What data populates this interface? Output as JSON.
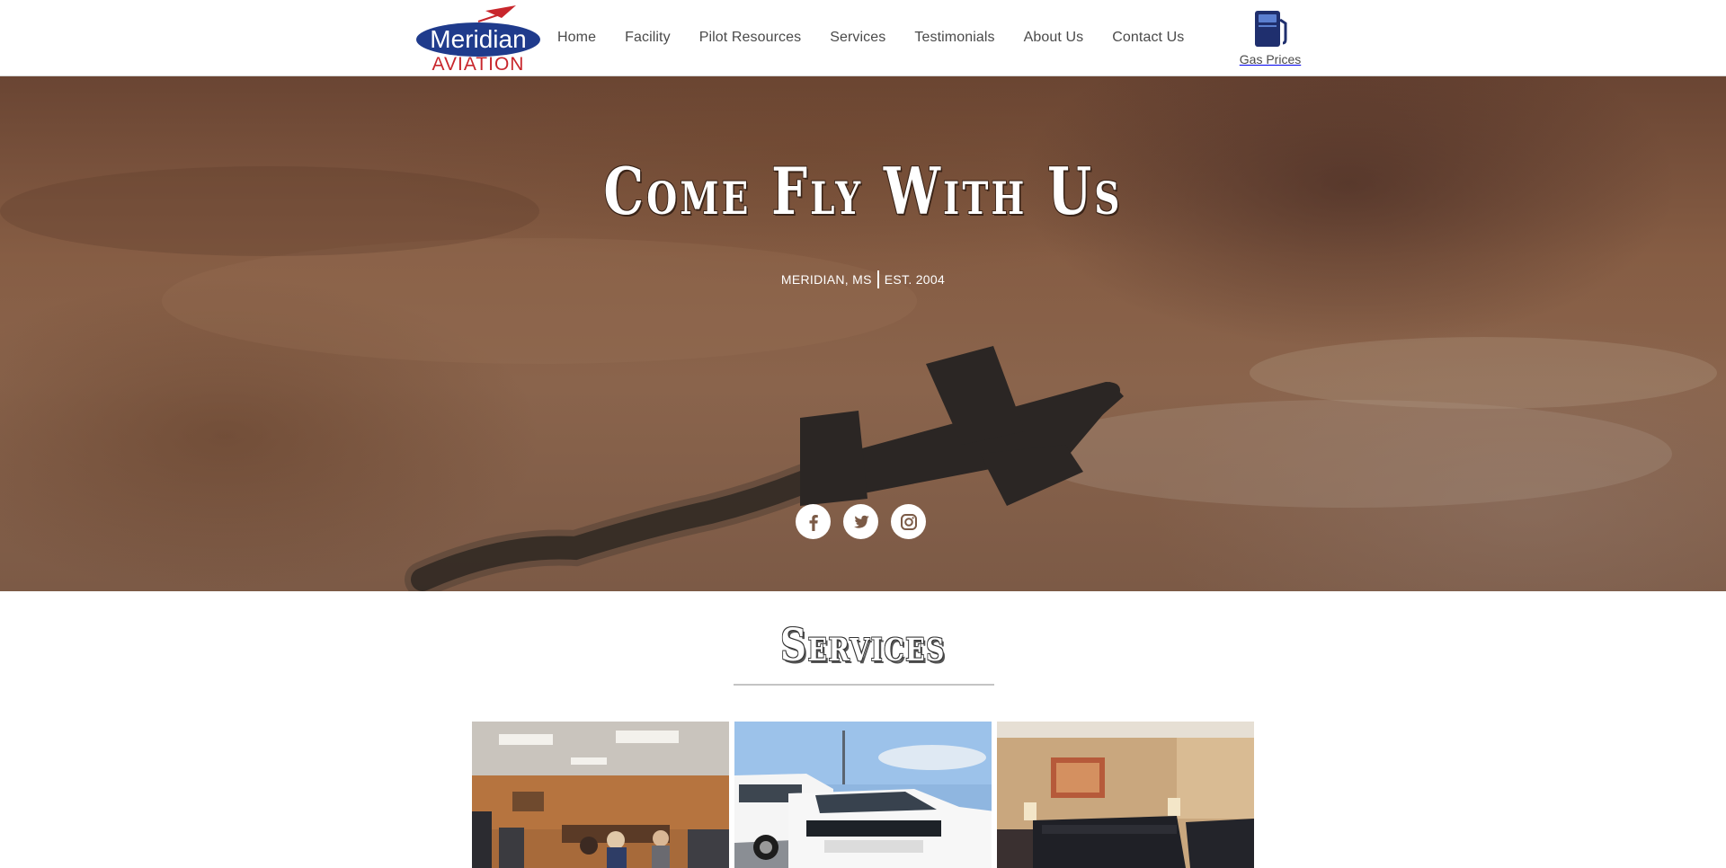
{
  "brand": {
    "logo_top": "Meridian",
    "logo_bottom": "AVIATION",
    "colors": {
      "blue": "#1f3b8c",
      "red": "#c8262c"
    }
  },
  "nav": {
    "items": [
      {
        "label": "Home"
      },
      {
        "label": "Facility"
      },
      {
        "label": "Pilot Resources"
      },
      {
        "label": "Services"
      },
      {
        "label": "Testimonials"
      },
      {
        "label": "About Us"
      },
      {
        "label": "Contact Us"
      }
    ]
  },
  "gas": {
    "label": "Gas Prices",
    "icon": "fuel-pump-icon"
  },
  "hero": {
    "title": "Come Fly With Us",
    "location": "MERIDIAN, MS",
    "established": "EST. 2004",
    "social": [
      {
        "name": "facebook",
        "icon": "facebook-icon"
      },
      {
        "name": "twitter",
        "icon": "twitter-icon"
      },
      {
        "name": "instagram",
        "icon": "instagram-icon"
      }
    ]
  },
  "services": {
    "title": "Services",
    "gallery": [
      {
        "subject": "lobby-with-vending"
      },
      {
        "subject": "courtesy-suvs"
      },
      {
        "subject": "pilot-lounge"
      }
    ]
  }
}
